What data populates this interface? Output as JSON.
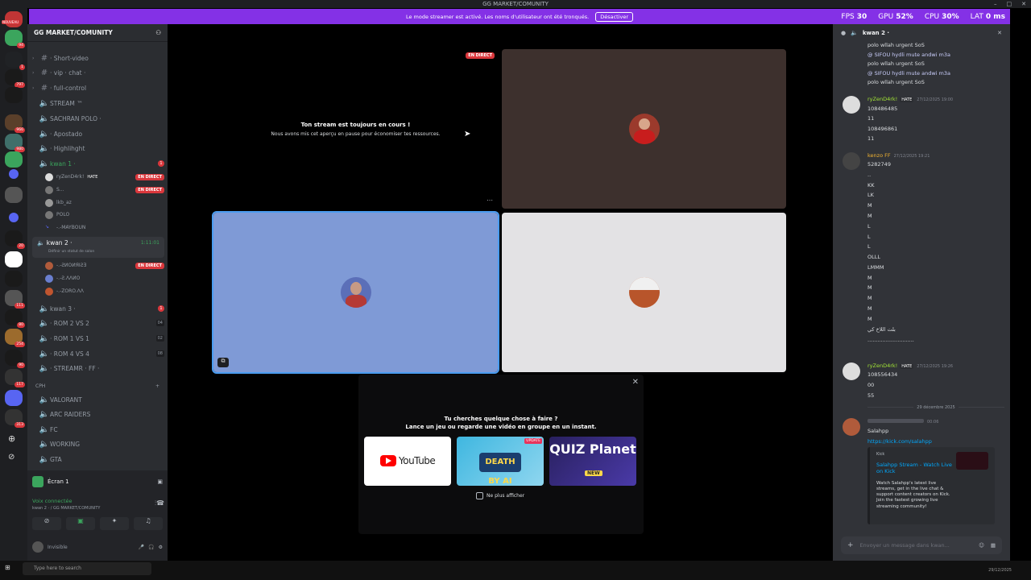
{
  "titlebar": {
    "title": "GG MARKET/COMUNITY",
    "buttons": [
      "–",
      "□",
      "✕"
    ]
  },
  "banner": {
    "message": "Le mode streamer est activé. Les noms d'utilisateur ont été tronqués.",
    "button": "Désactiver",
    "stats": [
      {
        "label": "FPS",
        "value": "30"
      },
      {
        "label": "GPU",
        "value": "52%"
      },
      {
        "label": "CPU",
        "value": "30%"
      },
      {
        "label": "LAT",
        "value": "0 ms"
      }
    ]
  },
  "servers": {
    "new_badge": "NOUVEAU",
    "badges": [
      "94",
      "1",
      "797",
      "966",
      "980",
      "20",
      "111",
      "80",
      "254",
      "90",
      "117",
      "313"
    ]
  },
  "sidebar": {
    "server_name": "GG MARKET/COMUNITY",
    "channels": [
      {
        "name": "· Short-video",
        "type": "text"
      },
      {
        "name": "· vip · chat ·",
        "type": "text"
      },
      {
        "name": "· full-control",
        "type": "text"
      },
      {
        "name": "STREAM ™",
        "type": "voice"
      },
      {
        "name": "SACHRAN POLO ·",
        "type": "voice"
      },
      {
        "name": "· Apostado",
        "type": "voice"
      },
      {
        "name": "· Highlihght",
        "type": "voice"
      },
      {
        "name": "kwan 1 ·",
        "type": "voice-active",
        "badge": "1"
      }
    ],
    "users1": [
      {
        "name": "ryZenD4rk!",
        "tag": "HATE",
        "live": "EN DIRECT"
      },
      {
        "name": "S...",
        "live": "EN DIRECT"
      },
      {
        "name": "lkb_az"
      },
      {
        "name": "POLO"
      },
      {
        "name": "-.-MAYBOUN"
      }
    ],
    "kwan2": {
      "name": "kwan 2 ·",
      "timer": "1:11:01",
      "status": "Définir un statut de salon"
    },
    "users2": [
      {
        "name": "-.-ƧИOИЯIƧƎ",
        "live": "EN DIRECT"
      },
      {
        "name": "-.-Ƨ.ΛΛИO"
      },
      {
        "name": "-.-ZORO.ΛΛ"
      }
    ],
    "channels2": [
      {
        "name": "kwan 3 ·",
        "badge": "1"
      },
      {
        "name": "· ROM 2 VS 2",
        "count": "04"
      },
      {
        "name": "· ROM 1 VS 1",
        "count": "02"
      },
      {
        "name": "· ROM 4 VS 4",
        "count": "08"
      },
      {
        "name": "· STREAMR · FF ·"
      }
    ],
    "category": "CPH",
    "channels3": [
      "VALORANT",
      "ARC RAIDERS",
      "FC",
      "WORKING",
      "GTA"
    ],
    "screen_label": "Écran 1",
    "voice_status": "Voix connectée",
    "voice_location": "kwan 2 · / GG MARKET/COMUNITY",
    "user_status": "Invisible"
  },
  "main": {
    "live_badge": "EN DIRECT",
    "paused_title": "Ton stream est toujours en cours !",
    "paused_sub": "Nous avons mis cet aperçu en pause pour économiser tes ressources.",
    "activity_title": "Tu cherches quelque chose à faire ?",
    "activity_sub": "Lance un jeu ou regarde une vidéo en groupe en un instant.",
    "cards": [
      "YouTube",
      "DEATH BY AI",
      "QUIZ Planet"
    ],
    "card_badges": [
      "UPDATE",
      "NEW"
    ],
    "dont_show": "Ne plus afficher",
    "colors": {
      "tile_brown": "#3d302d",
      "tile_blue": "#7f9ad6",
      "tile_gray": "#e3e2e4"
    }
  },
  "chat": {
    "header": "kwan 2 ·",
    "top_lines": [
      "polo wllah urgent SoS",
      "@ SIFOU hydli mute andwi m3a",
      "polo wllah urgent SoS",
      "@ SIFOU hydli mute andwi m3a",
      "polo wllah urgent SoS"
    ],
    "m1": {
      "author": "ryZenD4rk!",
      "tag": "HATE",
      "time": "27/12/2025 19:00",
      "lines": [
        "108486485",
        "11",
        "108496861",
        "11"
      ]
    },
    "m2": {
      "author": "kenzo FF",
      "time": "27/12/2025 19:21",
      "lines": [
        "5282749",
        "..",
        "KK",
        "LK",
        "M",
        "M",
        "L",
        "L",
        "L",
        "OLLL",
        "LMMM",
        "M",
        "M",
        "M",
        "M",
        "M",
        "بلت اللاخ كي",
        "............................"
      ]
    },
    "m3": {
      "author": "ryZenD4rk!",
      "tag": "HATE",
      "time": "27/12/2025 19:26",
      "lines": [
        "108556434",
        "00",
        "55"
      ]
    },
    "divider": "29 décembre 2025",
    "m4": {
      "time": "00:06",
      "text": "Salahpp",
      "link": "https://kick.com/salahpp",
      "embed_site": "Kick",
      "embed_title": "Salahpp Stream - Watch Live on Kick",
      "embed_desc": "Watch Salahpp's latest live streams, get in the live chat & support content creators on Kick. Join the fastest growing live streaming community!"
    },
    "input_placeholder": "Envoyer un message dans  kwan..."
  },
  "taskbar": {
    "search": "Type here to search",
    "date": "29/12/2025"
  }
}
